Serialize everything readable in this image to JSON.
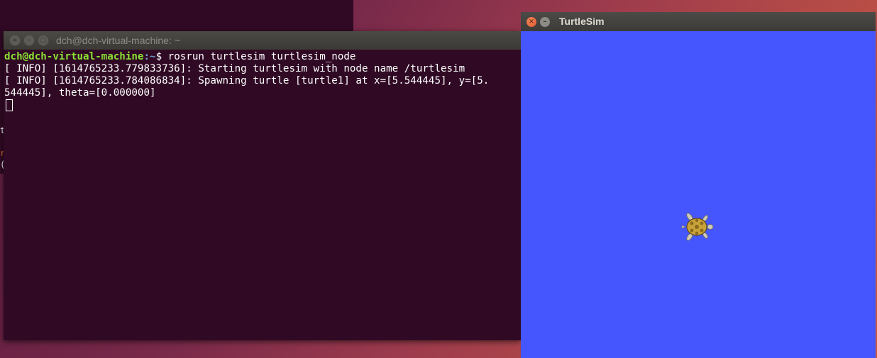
{
  "background_terminal": {
    "fragments": [
      "t",
      "",
      "r",
      "("
    ]
  },
  "terminal": {
    "title": "dch@dch-virtual-machine: ~",
    "prompt_user": "dch@dch-virtual-machine",
    "prompt_path": ":~",
    "prompt_symbol": "$ ",
    "command": "rosrun turtlesim turtlesim_node",
    "lines": [
      "[ INFO] [1614765233.779833736]: Starting turtlesim with node name /turtlesim",
      "[ INFO] [1614765233.784086834]: Spawning turtle [turtle1] at x=[5.544445], y=[5.",
      "544445], theta=[0.000000]"
    ],
    "close_glyph": "×",
    "minimize_glyph": "–",
    "maximize_glyph": "□"
  },
  "turtlesim": {
    "title": "TurtleSim",
    "background_color": "#4556ff",
    "close_glyph": "×",
    "minimize_glyph": "–",
    "turtle_icon": "turtle-icon"
  }
}
